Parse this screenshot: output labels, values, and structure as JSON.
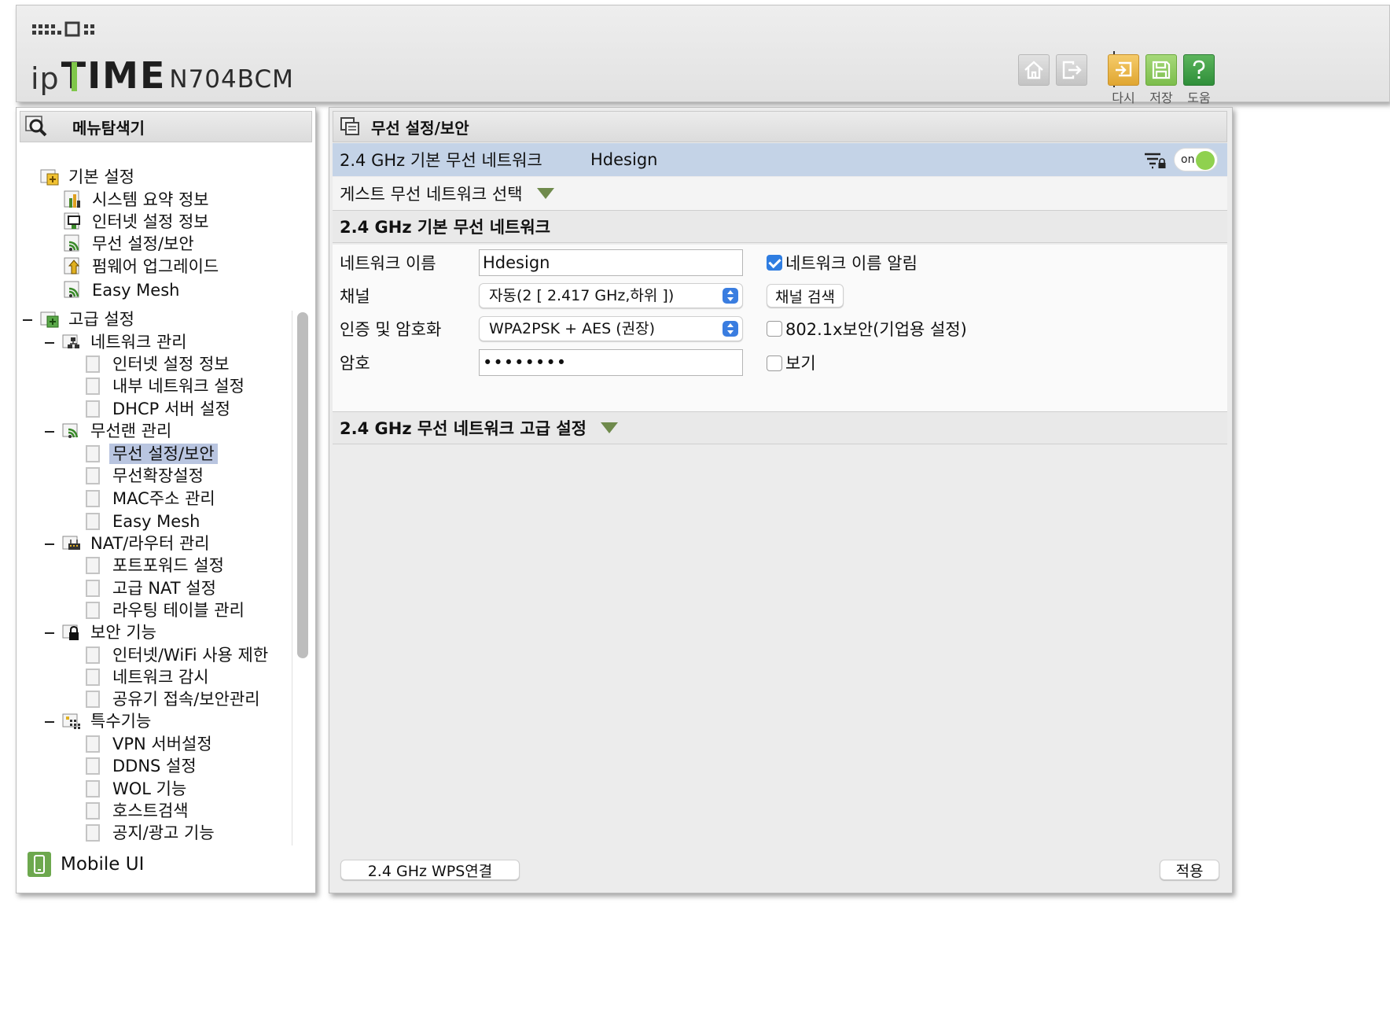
{
  "header": {
    "model": "N704BCM",
    "buttons": [
      {
        "name": "home",
        "label": ""
      },
      {
        "name": "logout",
        "label": ""
      },
      {
        "name": "reload",
        "label": "다시"
      },
      {
        "name": "save",
        "label": "저장"
      },
      {
        "name": "help",
        "label": "도움"
      }
    ]
  },
  "sidebar": {
    "title": "메뉴탐색기",
    "basic": {
      "label": "기본 설정",
      "items": [
        "시스템 요약 정보",
        "인터넷 설정 정보",
        "무선 설정/보안",
        "펌웨어 업그레이드",
        "Easy Mesh"
      ]
    },
    "advanced": {
      "label": "고급 설정",
      "groups": [
        {
          "label": "네트워크 관리",
          "items": [
            "인터넷 설정 정보",
            "내부 네트워크 설정",
            "DHCP 서버 설정"
          ]
        },
        {
          "label": "무선랜 관리",
          "items": [
            "무선 설정/보안",
            "무선확장설정",
            "MAC주소 관리",
            "Easy Mesh"
          ]
        },
        {
          "label": "NAT/라우터 관리",
          "items": [
            "포트포워드 설정",
            "고급 NAT 설정",
            "라우팅 테이블 관리"
          ]
        },
        {
          "label": "보안 기능",
          "items": [
            "인터넷/WiFi 사용 제한",
            "네트워크 감시",
            "공유기 접속/보안관리"
          ]
        },
        {
          "label": "특수기능",
          "items": [
            "VPN 서버설정",
            "DDNS 설정",
            "WOL 기능",
            "호스트검색",
            "공지/광고 기능"
          ]
        }
      ]
    },
    "mobile_label": "Mobile UI"
  },
  "main": {
    "title": "무선 설정/보안",
    "net_bar": {
      "label": "2.4 GHz 기본 무선 네트워크",
      "ssid": "Hdesign",
      "toggle": "on"
    },
    "guest_select": "게스트 무선 네트워크 선택",
    "section_basic": "2.4 GHz 기본 무선 네트워크",
    "form": {
      "name_label": "네트워크 이름",
      "name_value": "Hdesign",
      "broadcast_label": "네트워크 이름 알림",
      "broadcast_checked": true,
      "channel_label": "채널",
      "channel_value": "자동(2 [ 2.417 GHz,하위 ])",
      "channel_scan": "채널 검색",
      "auth_label": "인증 및 암호화",
      "auth_value": "WPA2PSK + AES (권장)",
      "enterprise_label": "802.1x보안(기업용 설정)",
      "enterprise_checked": false,
      "password_label": "암호",
      "password_value": "••••••••",
      "show_label": "보기",
      "show_checked": false
    },
    "section_advanced": "2.4 GHz 무선 네트워크 고급 설정",
    "wps_button": "2.4 GHz WPS연결",
    "apply_button": "적용"
  }
}
